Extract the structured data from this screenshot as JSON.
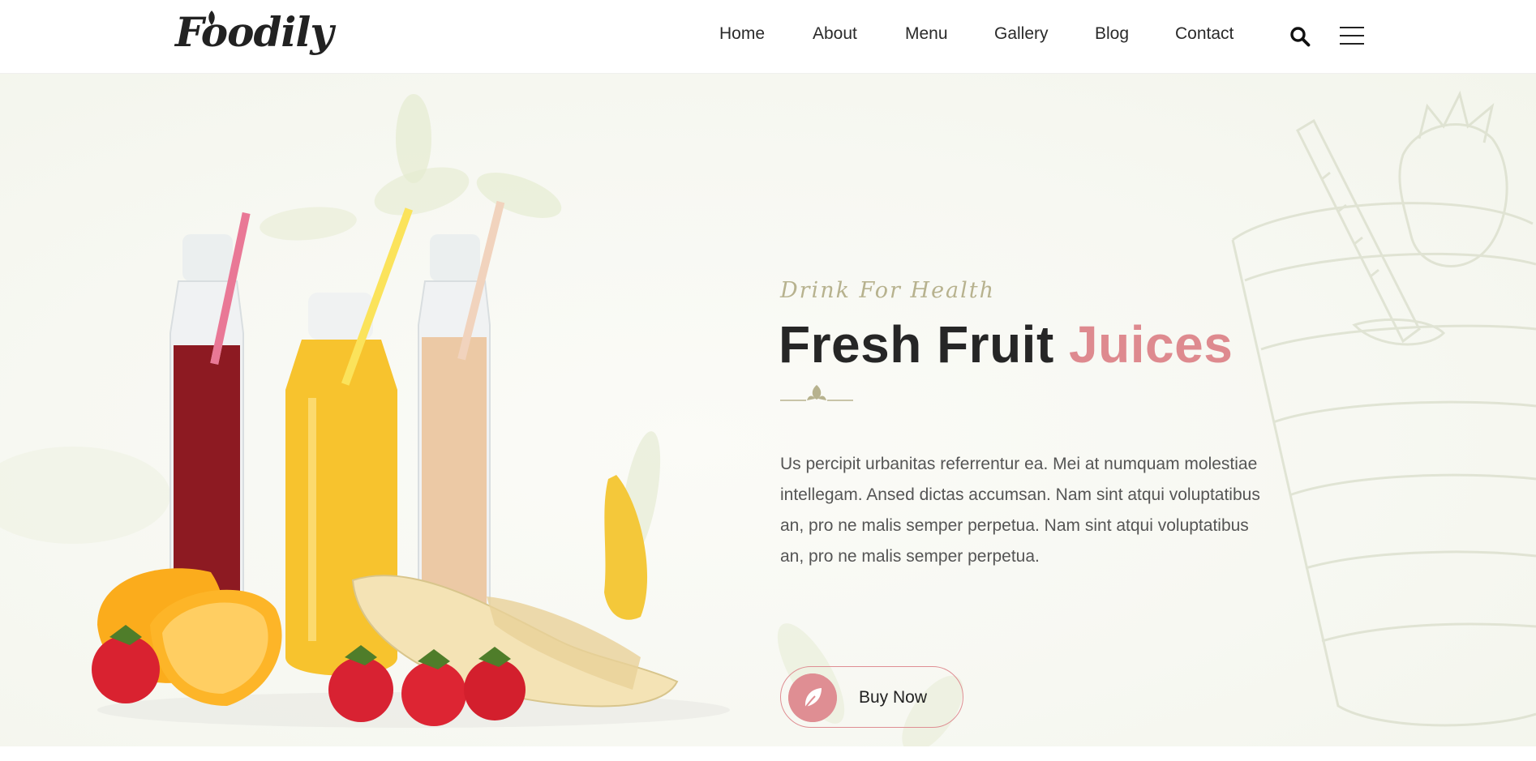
{
  "brand": {
    "name": "Foodily"
  },
  "nav": {
    "items": [
      {
        "label": "Home"
      },
      {
        "label": "About"
      },
      {
        "label": "Menu"
      },
      {
        "label": "Gallery"
      },
      {
        "label": "Blog"
      },
      {
        "label": "Contact"
      }
    ],
    "search_icon": "search-icon",
    "menu_icon": "hamburger-icon"
  },
  "hero": {
    "eyebrow": "Drink For Health",
    "title_main": "Fresh Fruit ",
    "title_accent": "Juices",
    "description": "Us percipit urbanitas referrentur ea. Mei at numquam molestiae intellegam. Ansed dictas accumsan. Nam sint atqui voluptatibus an, pro ne malis semper perpetua. Nam sint atqui voluptatibus an, pro ne malis semper perpetua.",
    "button_label": "Buy Now",
    "button_icon": "leaf-icon"
  },
  "colors": {
    "accent": "#de8a8f",
    "eyebrow": "#b7b28e",
    "text": "#262626",
    "body_text": "#555555"
  }
}
